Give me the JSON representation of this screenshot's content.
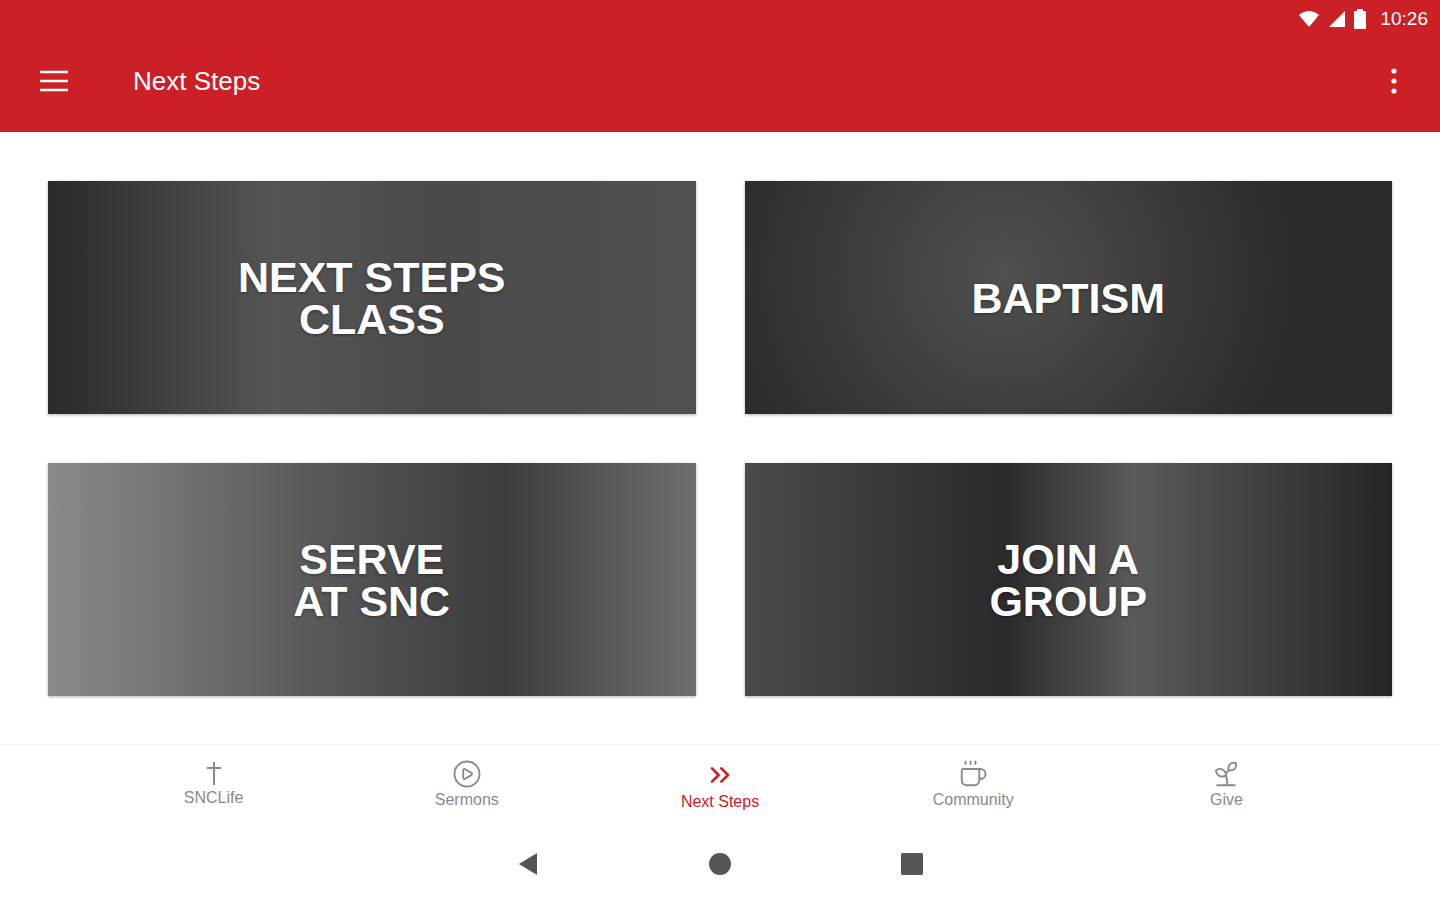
{
  "status_bar": {
    "time": "10:26"
  },
  "app_bar": {
    "title": "Next Steps"
  },
  "cards": [
    {
      "lines": [
        "NEXT STEPS",
        "CLASS"
      ]
    },
    {
      "lines": [
        "BAPTISM"
      ]
    },
    {
      "lines": [
        "SERVE",
        "AT SNC"
      ]
    },
    {
      "lines": [
        "JOIN A",
        "GROUP"
      ]
    }
  ],
  "bottom_nav": [
    {
      "label": "SNCLife",
      "selected": false
    },
    {
      "label": "Sermons",
      "selected": false
    },
    {
      "label": "Next Steps",
      "selected": true
    },
    {
      "label": "Community",
      "selected": false
    },
    {
      "label": "Give",
      "selected": false
    }
  ]
}
